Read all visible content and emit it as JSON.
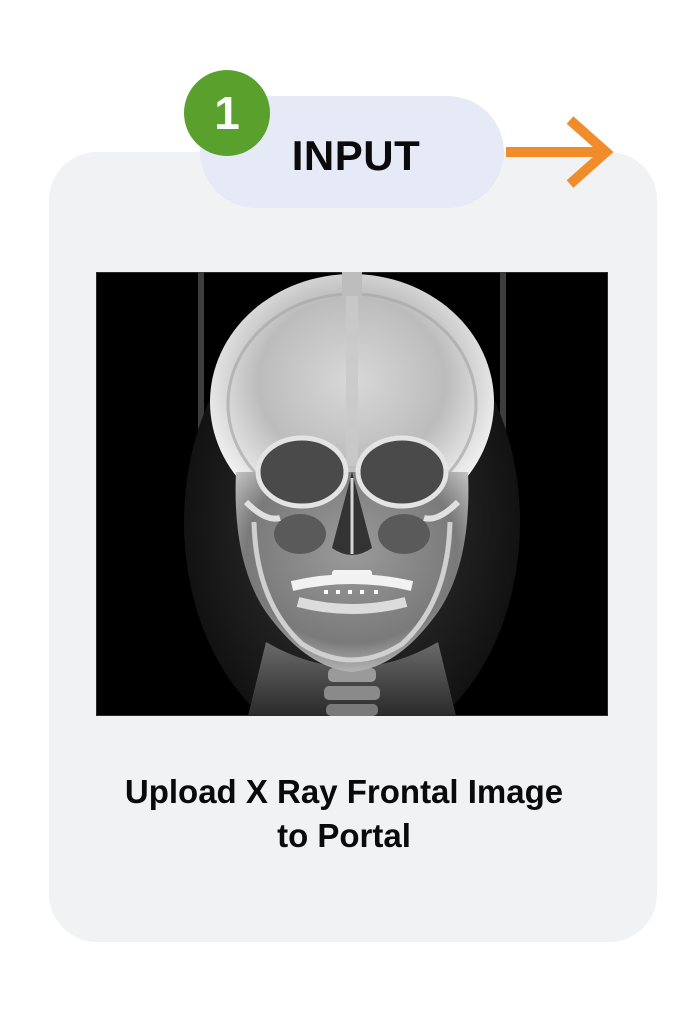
{
  "step": {
    "number": "1",
    "title": "INPUT",
    "badge_color": "#5aa02c",
    "pill_color": "#e6eaf7",
    "arrow_color": "#f08c2a"
  },
  "card": {
    "background_color": "#f1f2f4",
    "image_icon": "xray-skull-frontal-image",
    "caption_line1": "Upload X Ray  Frontal Image",
    "caption_line2": "to Portal"
  }
}
